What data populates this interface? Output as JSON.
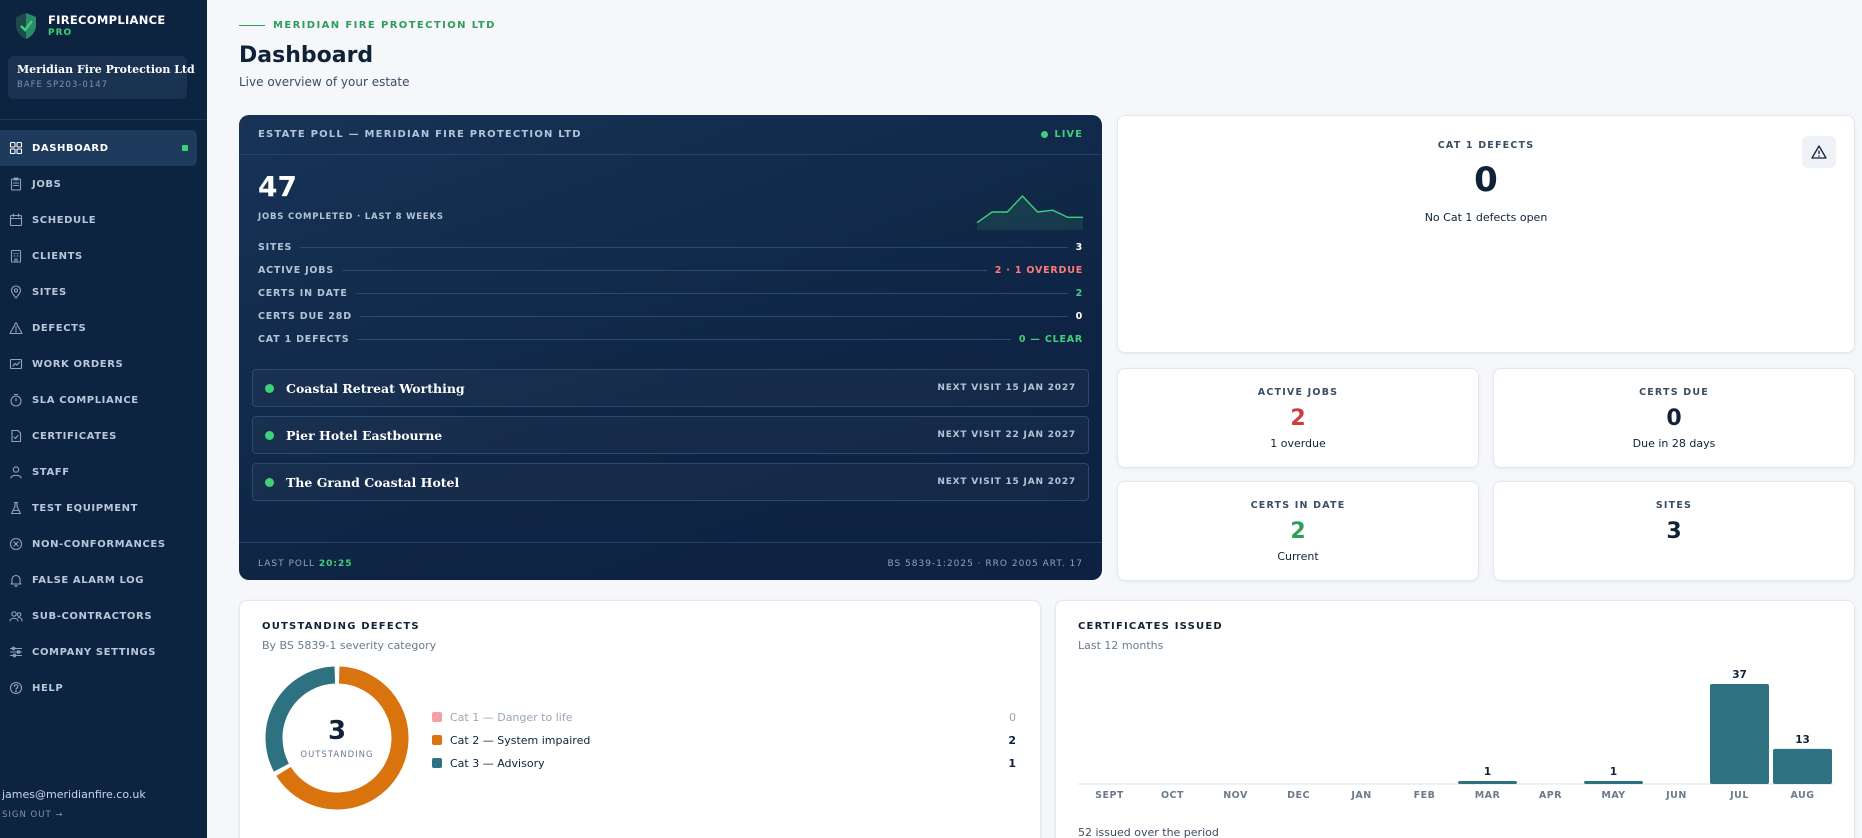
{
  "brand": {
    "name": "FIRECOMPLIANCE",
    "tier": "PRO",
    "accent": "#3fd17a"
  },
  "company": {
    "name": "Meridian Fire Protection Ltd",
    "id": "BAFE SP203-0147"
  },
  "nav": [
    {
      "label": "DASHBOARD",
      "icon": "grid-icon",
      "active": true
    },
    {
      "label": "JOBS",
      "icon": "clipboard-icon"
    },
    {
      "label": "SCHEDULE",
      "icon": "calendar-icon"
    },
    {
      "label": "CLIENTS",
      "icon": "building-icon"
    },
    {
      "label": "SITES",
      "icon": "map-pin-icon"
    },
    {
      "label": "DEFECTS",
      "icon": "warning-icon"
    },
    {
      "label": "WORK ORDERS",
      "icon": "work-order-icon"
    },
    {
      "label": "SLA COMPLIANCE",
      "icon": "stopwatch-icon"
    },
    {
      "label": "CERTIFICATES",
      "icon": "certificate-icon"
    },
    {
      "label": "STAFF",
      "icon": "person-icon"
    },
    {
      "label": "TEST EQUIPMENT",
      "icon": "flask-icon"
    },
    {
      "label": "NON-CONFORMANCES",
      "icon": "x-circle-icon"
    },
    {
      "label": "FALSE ALARM LOG",
      "icon": "bell-icon"
    },
    {
      "label": "SUB-CONTRACTORS",
      "icon": "people-icon"
    },
    {
      "label": "COMPANY SETTINGS",
      "icon": "sliders-icon"
    },
    {
      "label": "HELP",
      "icon": "help-icon"
    }
  ],
  "user": {
    "email": "james@meridianfire.co.uk",
    "sign_out": "SIGN OUT →"
  },
  "header": {
    "kicker": "MERIDIAN FIRE PROTECTION LTD",
    "title": "Dashboard",
    "subtitle": "Live overview of your estate"
  },
  "poll": {
    "title": "ESTATE POLL — MERIDIAN FIRE PROTECTION LTD",
    "live": "LIVE",
    "big_value": "47",
    "big_label": "JOBS COMPLETED · LAST 8 WEEKS",
    "sparkline": [
      3,
      9,
      9,
      18,
      9,
      10,
      6,
      6
    ],
    "metrics": [
      {
        "label": "SITES",
        "value": "3",
        "tone": "normal"
      },
      {
        "label": "ACTIVE JOBS",
        "value": "2 · 1 OVERDUE",
        "tone": "warn"
      },
      {
        "label": "CERTS IN DATE",
        "value": "2",
        "tone": "ok"
      },
      {
        "label": "CERTS DUE 28D",
        "value": "0",
        "tone": "normal"
      },
      {
        "label": "CAT 1 DEFECTS",
        "value": "0 — CLEAR",
        "tone": "ok"
      }
    ],
    "sites": [
      {
        "name": "Coastal Retreat Worthing",
        "next": "NEXT VISIT 15 JAN 2027"
      },
      {
        "name": "Pier Hotel Eastbourne",
        "next": "NEXT VISIT 22 JAN 2027"
      },
      {
        "name": "The Grand Coastal Hotel",
        "next": "NEXT VISIT 15 JAN 2027"
      }
    ],
    "last_poll_label": "LAST POLL",
    "last_poll_time": "20:25",
    "standard": "BS 5839-1:2025 · RRO 2005 ART. 17"
  },
  "stats": {
    "cat1": {
      "label": "CAT 1 DEFECTS",
      "value": "0",
      "sub": "No Cat 1 defects open"
    },
    "active_jobs": {
      "label": "ACTIVE JOBS",
      "value": "2",
      "sub": "1 overdue"
    },
    "certs_due": {
      "label": "CERTS DUE",
      "value": "0",
      "sub": "Due in 28 days"
    },
    "certs_in_date": {
      "label": "CERTS IN DATE",
      "value": "2",
      "sub": "Current"
    },
    "sites": {
      "label": "SITES",
      "value": "3"
    }
  },
  "defects": {
    "title": "OUTSTANDING DEFECTS",
    "subtitle": "By BS 5839-1 severity category",
    "total": "3",
    "total_label": "OUTSTANDING",
    "items": [
      {
        "name": "Cat 1 — Danger to life",
        "count": 0,
        "color": "#f2a0a6"
      },
      {
        "name": "Cat 2 — System impaired",
        "count": 2,
        "color": "#d9730d"
      },
      {
        "name": "Cat 3 — Advisory",
        "count": 1,
        "color": "#2e7180"
      }
    ]
  },
  "certificates": {
    "title": "CERTIFICATES ISSUED",
    "subtitle": "Last 12 months",
    "footer": "52 issued over the period",
    "bar_color": "#2e7180"
  },
  "chart_data": {
    "type": "bar",
    "categories": [
      "SEPT",
      "OCT",
      "NOV",
      "DEC",
      "JAN",
      "FEB",
      "MAR",
      "APR",
      "MAY",
      "JUN",
      "JUL",
      "AUG"
    ],
    "values": [
      0,
      0,
      0,
      0,
      0,
      0,
      1,
      0,
      1,
      0,
      37,
      13
    ],
    "title": "CERTIFICATES ISSUED",
    "subtitle": "Last 12 months",
    "xlabel": "",
    "ylabel": "",
    "ylim": [
      0,
      37
    ],
    "grid": false
  }
}
